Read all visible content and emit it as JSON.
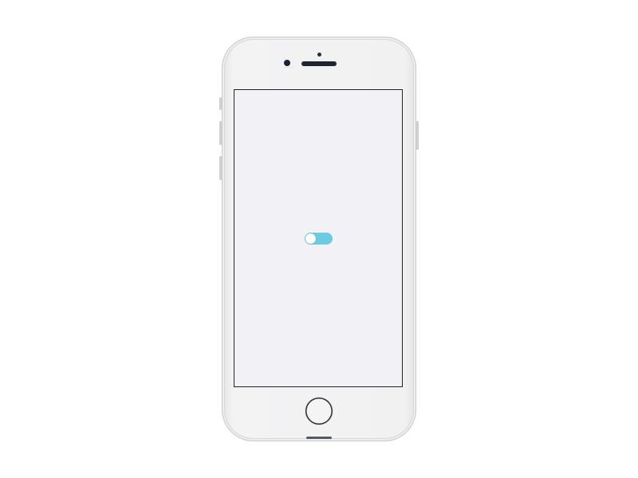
{
  "device": {
    "type": "phone",
    "body_color": "#f1f1f2",
    "screen_background": "#f2f2f6"
  },
  "screen": {
    "toggle": {
      "state": "off",
      "track_color": "#6bcbe3",
      "knob_color": "#ffffff"
    }
  },
  "icons": {
    "camera": "front-camera-icon",
    "speaker": "earpiece-speaker-icon",
    "home": "home-button-icon"
  }
}
